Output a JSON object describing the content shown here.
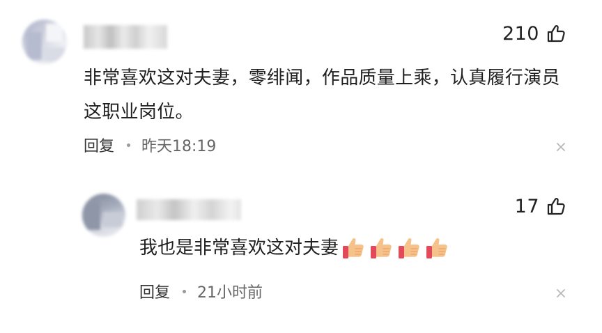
{
  "comment": {
    "like_count": "210",
    "text": "非常喜欢这对夫妻，零绯闻，作品质量上乘，认真履行演员这职业岗位。",
    "reply_label": "回复",
    "time": "昨天18:19",
    "icons": {
      "like": "thumbs-up-outline-icon",
      "close": "close-icon"
    }
  },
  "reply": {
    "like_count": "17",
    "text": "我也是非常喜欢这对夫妻",
    "emoji": [
      "thumbs-up-emoji",
      "thumbs-up-emoji",
      "thumbs-up-emoji",
      "thumbs-up-emoji"
    ],
    "reply_label": "回复",
    "time": "21小时前",
    "icons": {
      "like": "thumbs-up-outline-icon",
      "close": "close-icon"
    }
  },
  "colors": {
    "text": "#1f1f1f",
    "meta_text": "#333333",
    "time_text": "#666666",
    "emoji_skin": "#f6c28b",
    "emoji_cuff": "#e24a5a"
  }
}
